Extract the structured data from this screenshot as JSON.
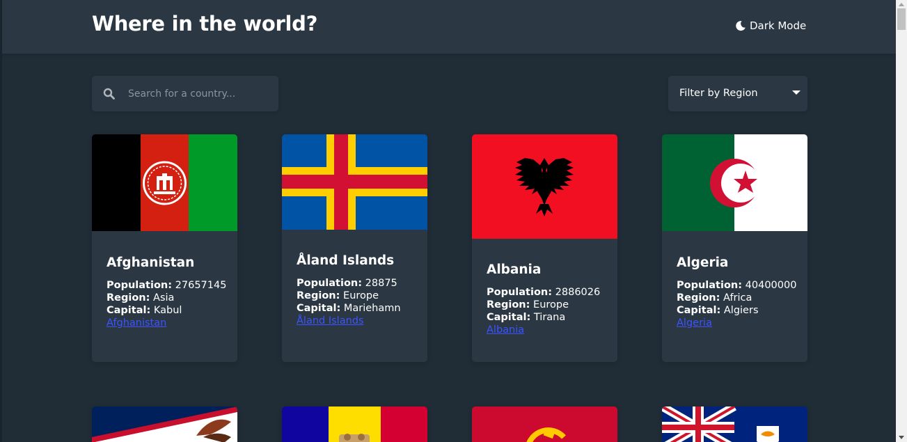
{
  "header": {
    "title": "Where in the world?",
    "dark_mode_label": "Dark Mode"
  },
  "search": {
    "value": "",
    "placeholder": "Search for a country..."
  },
  "filter": {
    "label": "Filter by Region"
  },
  "labels": {
    "population": "Population:",
    "region": "Region:",
    "capital": "Capital:"
  },
  "countries": [
    {
      "name": "Afghanistan",
      "population": "27657145",
      "region": "Asia",
      "capital": "Kabul",
      "link": "Afghanistan",
      "flag": "afghanistan-flag"
    },
    {
      "name": "Åland Islands",
      "population": "28875",
      "region": "Europe",
      "capital": "Mariehamn",
      "link": "Åland Islands",
      "flag": "aland-islands-flag"
    },
    {
      "name": "Albania",
      "population": "2886026",
      "region": "Europe",
      "capital": "Tirana",
      "link": "Albania",
      "flag": "albania-flag"
    },
    {
      "name": "Algeria",
      "population": "40400000",
      "region": "Africa",
      "capital": "Algiers",
      "link": "Algeria",
      "flag": "algeria-flag"
    },
    {
      "flag": "american-samoa-flag"
    },
    {
      "flag": "andorra-flag"
    },
    {
      "flag": "angola-flag"
    },
    {
      "flag": "anguilla-flag"
    }
  ],
  "colors": {
    "background": "#202c36",
    "element": "#2b3844",
    "text": "#ffffff",
    "link": "#3b54ff"
  }
}
